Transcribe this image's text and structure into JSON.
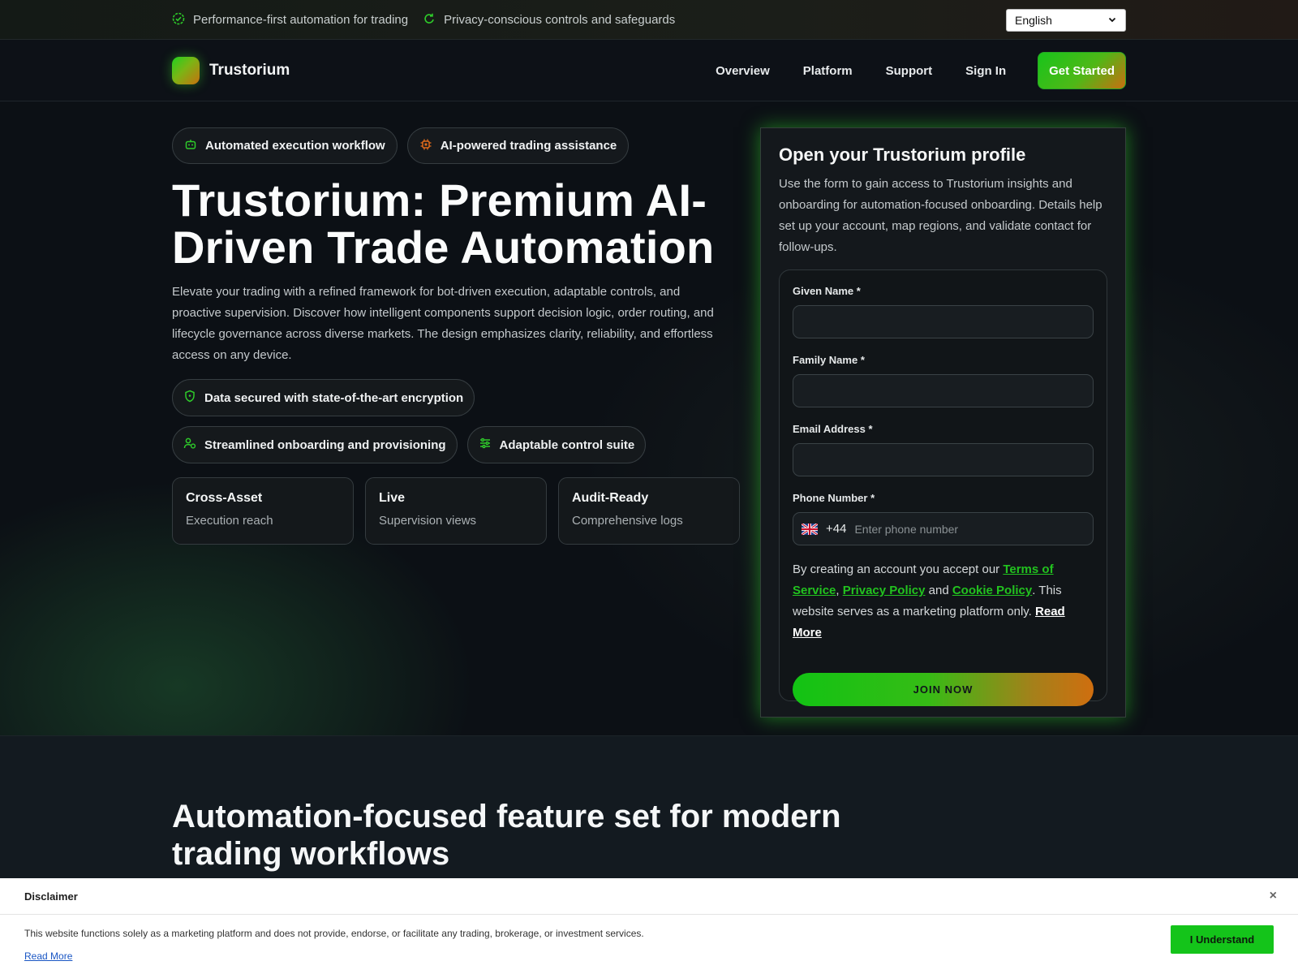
{
  "topbar": {
    "item1": "Performance-first automation for trading",
    "item2": "Privacy-conscious controls and safeguards",
    "language": "English"
  },
  "header": {
    "brand": "Trustorium",
    "nav": [
      "Overview",
      "Platform",
      "Support",
      "Sign In"
    ],
    "cta": "Get Started"
  },
  "hero": {
    "chips": [
      "Automated execution workflow",
      "AI-powered trading assistance"
    ],
    "title": "Trustorium: Premium AI-Driven Trade Automation",
    "lead": "Elevate your trading with a refined framework for bot-driven execution, adaptable controls, and proactive supervision. Discover how intelligent components support decision logic, order routing, and lifecycle governance across diverse markets. The design emphasizes clarity, reliability, and effortless access on any device.",
    "features": [
      "Data secured with state-of-the-art encryption",
      "Streamlined onboarding and provisioning",
      "Adaptable control suite"
    ],
    "stats": [
      {
        "title": "Cross-Asset",
        "sub": "Execution reach"
      },
      {
        "title": "Live",
        "sub": "Supervision views"
      },
      {
        "title": "Audit-Ready",
        "sub": "Comprehensive logs"
      }
    ]
  },
  "form": {
    "title": "Open your Trustorium profile",
    "desc": "Use the form to gain access to Trustorium insights and onboarding for automation-focused onboarding. Details help set up your account, map regions, and validate contact for follow-ups.",
    "given_label": "Given Name *",
    "family_label": "Family Name *",
    "email_label": "Email Address *",
    "phone_label": "Phone Number *",
    "phone_code": "+44",
    "phone_placeholder": "Enter phone number",
    "legal_prefix": "By creating an account you accept our ",
    "terms": "Terms of Service",
    "comma": ",",
    "privacy": "Privacy Policy",
    "and": " and ",
    "cookie": "Cookie Policy",
    "legal_mid": ". This website serves as a marketing platform only. ",
    "read_more": "Read More",
    "submit": "JOIN NOW"
  },
  "section2": {
    "title": "Automation-focused feature set for modern trading workflows"
  },
  "disclaimer": {
    "title": "Disclaimer",
    "close": "×",
    "text": "This website functions solely as a marketing platform and does not provide, endorse, or facilitate any trading, brokerage, or investment services.",
    "read_more": "Read More",
    "ok": "I Understand"
  },
  "colors": {
    "accent_green": "#18c41b",
    "accent_orange": "#c96e10",
    "background": "#0c1015"
  },
  "icons": [
    "badge-check-icon",
    "shield-refresh-icon",
    "chevron-down-icon",
    "robot-icon",
    "chip-icon",
    "shield-icon",
    "user-plus-icon",
    "sliders-icon",
    "uk-flag-icon",
    "close-icon"
  ]
}
